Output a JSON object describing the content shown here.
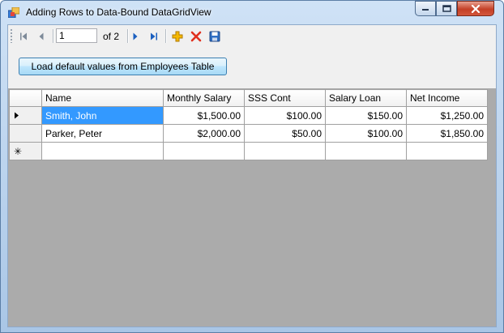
{
  "window": {
    "title": "Adding Rows to Data-Bound DataGridView"
  },
  "navigator": {
    "position": "1",
    "count_text": "of 2"
  },
  "actions": {
    "load_label": "Load default values from Employees Table"
  },
  "grid": {
    "columns": [
      "Name",
      "Monthly Salary",
      "SSS Cont",
      "Salary Loan",
      "Net Income"
    ],
    "rows": [
      [
        "Smith, John",
        "$1,500.00",
        "$100.00",
        "$150.00",
        "$1,250.00"
      ],
      [
        "Parker, Peter",
        "$2,000.00",
        "$50.00",
        "$100.00",
        "$1,850.00"
      ]
    ],
    "new_row_marker": "✳"
  },
  "icons": [
    "app-icon",
    "minimize-icon",
    "maximize-icon",
    "close-icon",
    "move-first-icon",
    "move-previous-icon",
    "move-next-icon",
    "move-last-icon",
    "add-new-icon",
    "delete-icon",
    "save-icon",
    "current-row-arrow-icon"
  ],
  "colors": {
    "selection": "#3399ff",
    "grid_background": "#ababab",
    "delete_red": "#e0301e",
    "add_yellow": "#f5b800",
    "save_blue": "#2f6fc4"
  }
}
